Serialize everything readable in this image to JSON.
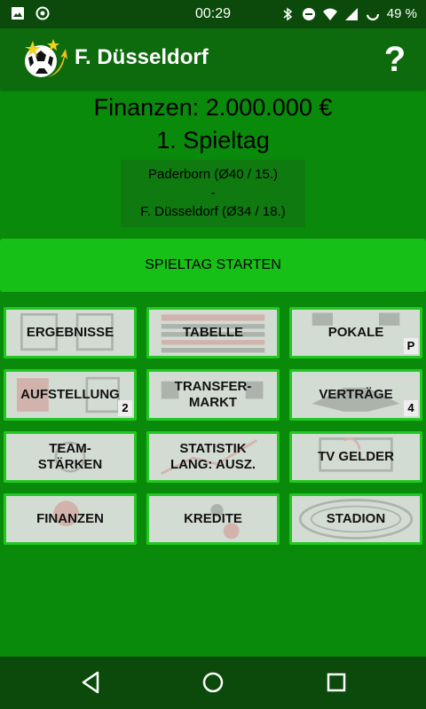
{
  "status": {
    "time": "00:29",
    "battery": "49 %",
    "icons": [
      "image-icon",
      "record-icon",
      "bluetooth-icon",
      "do-not-disturb-icon",
      "wifi-icon",
      "signal-icon",
      "battery-icon"
    ]
  },
  "appbar": {
    "title": "F. Düsseldorf",
    "help": "?"
  },
  "info": {
    "finance": "Finanzen: 2.000.000 €",
    "matchday": "1. Spieltag",
    "home": "Paderborn (Ø40 / 15.)",
    "separator": "-",
    "away": "F. Düsseldorf (Ø34 / 18.)"
  },
  "start_button": "SPIELTAG STARTEN",
  "tiles": {
    "ergebnisse": {
      "label": "ERGEBNISSE"
    },
    "tabelle": {
      "label": "TABELLE"
    },
    "pokale": {
      "label": "POKALE",
      "badge": "P"
    },
    "aufstellung": {
      "label": "AUFSTELLUNG",
      "badge": "2"
    },
    "transfermarkt": {
      "label": "TRANSFER-\nMARKT"
    },
    "vertraege": {
      "label": "VERTRÄGE",
      "badge": "4"
    },
    "teamstaerken": {
      "label": "TEAM-\nSTÄRKEN"
    },
    "statistik": {
      "label": "STATISTIK\nLANG: AUSZ."
    },
    "tvgelder": {
      "label": "TV GELDER"
    },
    "finanzen": {
      "label": "FINANZEN"
    },
    "kredite": {
      "label": "KREDITE"
    },
    "stadion": {
      "label": "STADION"
    }
  },
  "colors": {
    "background": "#0a8a0a",
    "status_bar": "#0b4a0b",
    "app_bar": "#0d6b0d",
    "start_button": "#16c016",
    "tile_border": "#22c822",
    "tile_fill": "#d3dcd3"
  }
}
